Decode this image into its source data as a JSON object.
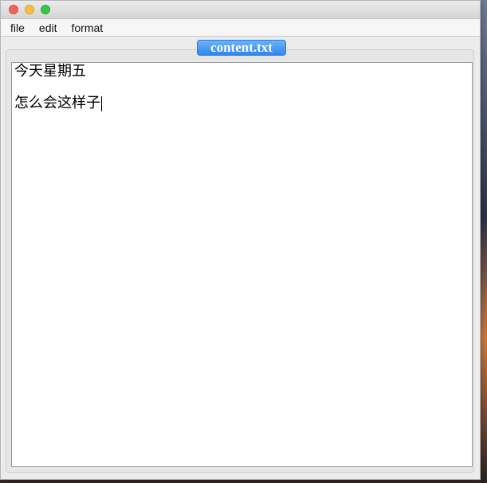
{
  "menubar": {
    "items": [
      "file",
      "edit",
      "format"
    ]
  },
  "tab": {
    "label": "content.txt"
  },
  "editor": {
    "lines": [
      "今天星期五",
      "怎么会这样子"
    ]
  }
}
